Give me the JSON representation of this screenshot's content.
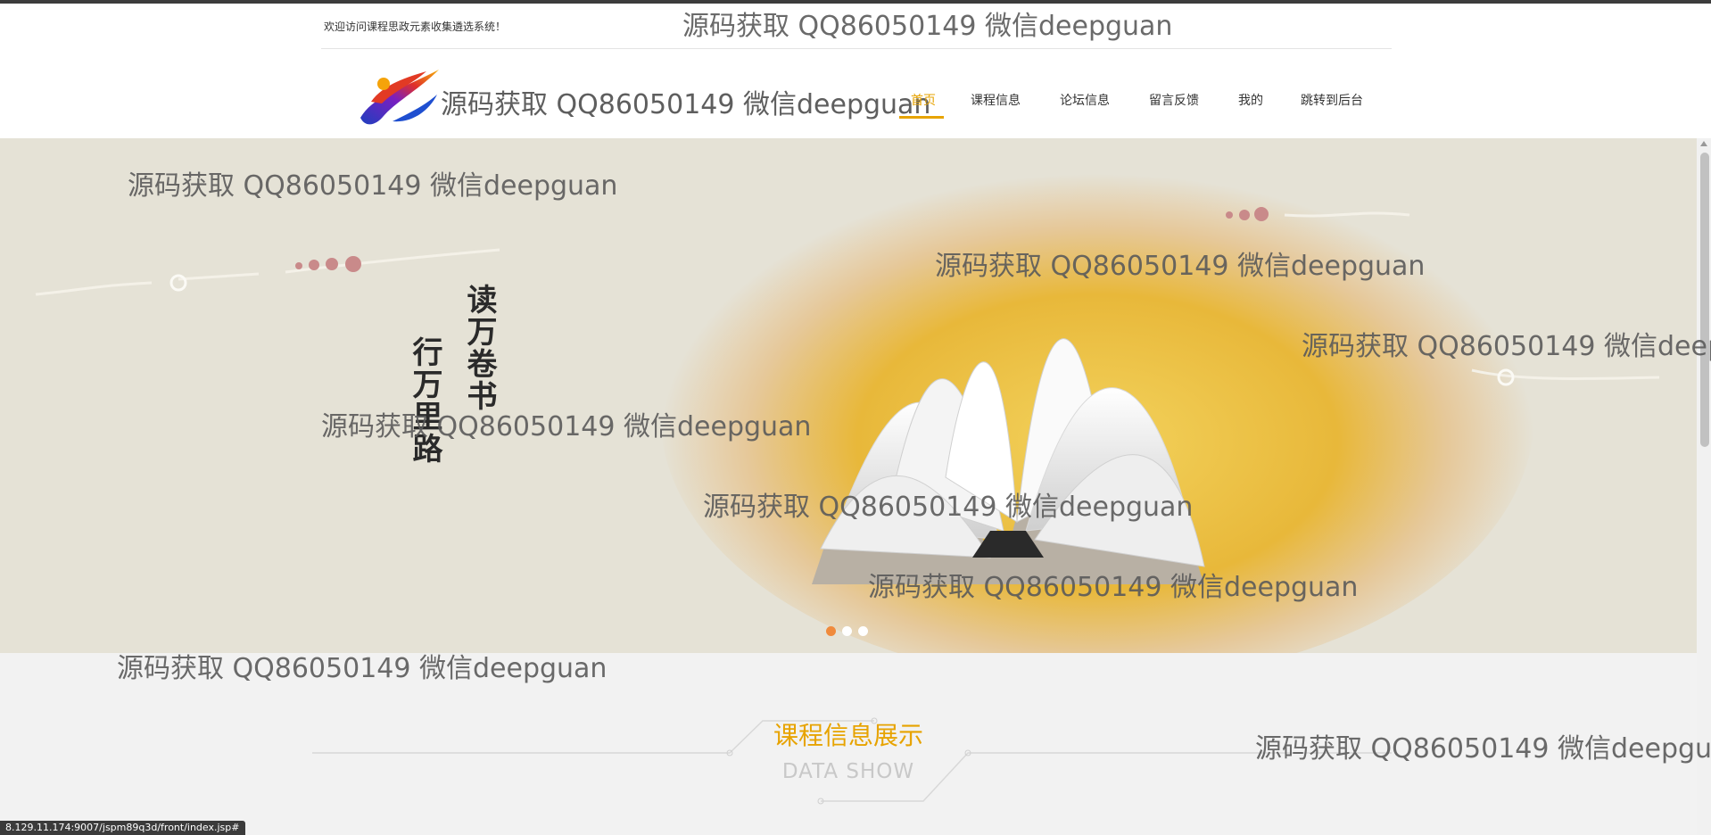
{
  "header": {
    "welcome": "欢迎访问课程思政元素收集遴选系统！",
    "title": "源码获取 QQ86050149 微信deepguan"
  },
  "nav": {
    "items": [
      {
        "label": "首页",
        "active": true
      },
      {
        "label": "课程信息"
      },
      {
        "label": "论坛信息"
      },
      {
        "label": "留言反馈"
      },
      {
        "label": "我的"
      },
      {
        "label": "跳转到后台"
      }
    ],
    "active_color": "#e7a300"
  },
  "banner": {
    "text_col1": "读万卷书",
    "text_col2": "行万里路",
    "dots_total": 3,
    "dot_active_color": "#f08a3c"
  },
  "section": {
    "title": "课程信息展示",
    "subtitle": "DATA SHOW"
  },
  "watermark_text": "源码获取 QQ86050149 微信deepguan",
  "status_url": "8.129.11.174:9007/jspm89q3d/front/index.jsp#",
  "icons": {
    "logo": "swirl-logo-icon"
  }
}
